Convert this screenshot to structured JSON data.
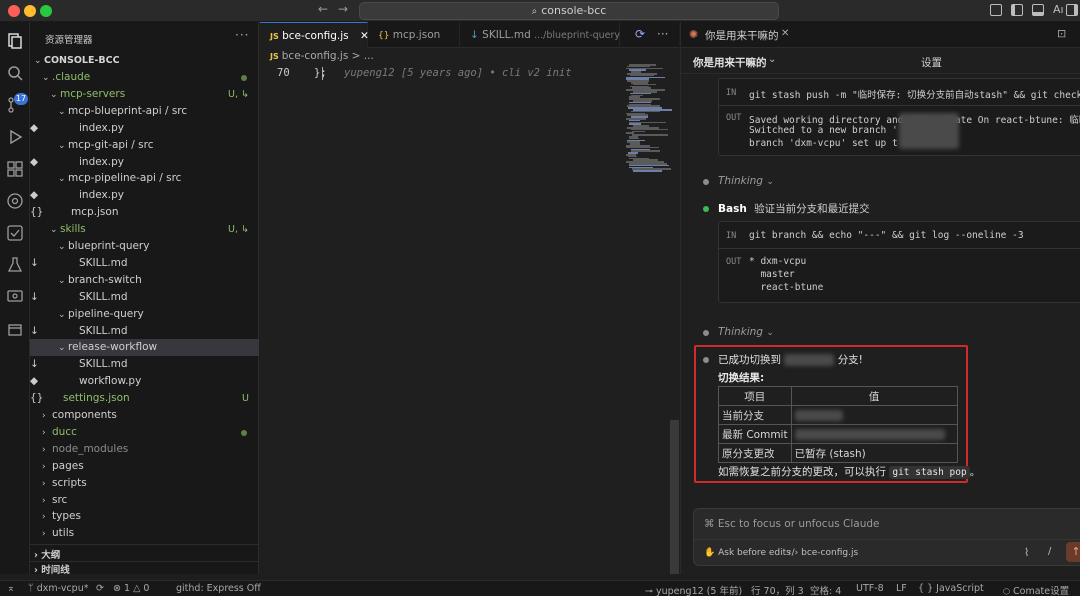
{
  "window": {
    "search": "console-bcc",
    "traffic_colors": [
      "#fe5f57",
      "#febc2e",
      "#28c840"
    ]
  },
  "activity": {
    "scm_badge": "17"
  },
  "explorer": {
    "title": "资源管理器",
    "more": "···",
    "project": "CONSOLE-BCC",
    "tree": [
      {
        "label": ".claude",
        "type": "folder",
        "open": true,
        "indent": 1,
        "color": "#8fbf6a",
        "dot": true
      },
      {
        "label": "mcp-servers",
        "type": "folder",
        "open": true,
        "indent": 2,
        "color": "#8fbf6a",
        "status": "U, ↳"
      },
      {
        "label": "mcp-blueprint-api / src",
        "type": "folder",
        "open": true,
        "indent": 3,
        "color": "#d0d0d0"
      },
      {
        "label": "index.py",
        "type": "py",
        "indent": 4,
        "color": "#d0d0d0"
      },
      {
        "label": "mcp-git-api / src",
        "type": "folder",
        "open": true,
        "indent": 3,
        "color": "#d0d0d0"
      },
      {
        "label": "index.py",
        "type": "py",
        "indent": 4,
        "color": "#d0d0d0"
      },
      {
        "label": "mcp-pipeline-api / src",
        "type": "folder",
        "open": true,
        "indent": 3,
        "color": "#d0d0d0"
      },
      {
        "label": "index.py",
        "type": "py",
        "indent": 4,
        "color": "#d0d0d0"
      },
      {
        "label": "mcp.json",
        "type": "json",
        "indent": 3,
        "color": "#d0d0d0"
      },
      {
        "label": "skills",
        "type": "folder",
        "open": true,
        "indent": 2,
        "color": "#8fbf6a",
        "status": "U, ↳"
      },
      {
        "label": "blueprint-query",
        "type": "folder",
        "open": true,
        "indent": 3,
        "color": "#d0d0d0"
      },
      {
        "label": "SKILL.md",
        "type": "md",
        "indent": 4,
        "color": "#d0d0d0"
      },
      {
        "label": "branch-switch",
        "type": "folder",
        "open": true,
        "indent": 3,
        "color": "#d0d0d0"
      },
      {
        "label": "SKILL.md",
        "type": "md",
        "indent": 4,
        "color": "#d0d0d0"
      },
      {
        "label": "pipeline-query",
        "type": "folder",
        "open": true,
        "indent": 3,
        "color": "#d0d0d0"
      },
      {
        "label": "SKILL.md",
        "type": "md",
        "indent": 4,
        "color": "#d0d0d0"
      },
      {
        "label": "release-workflow",
        "type": "folder",
        "open": true,
        "indent": 3,
        "color": "#d0d0d0",
        "selected": true
      },
      {
        "label": "SKILL.md",
        "type": "md",
        "indent": 4,
        "color": "#d0d0d0"
      },
      {
        "label": "workflow.py",
        "type": "py",
        "indent": 4,
        "color": "#d0d0d0"
      },
      {
        "label": "settings.json",
        "type": "json",
        "indent": 2,
        "color": "#8fbf6a",
        "status": "U"
      },
      {
        "label": "components",
        "type": "folder",
        "open": false,
        "indent": 1,
        "color": "#d0d0d0"
      },
      {
        "label": "ducc",
        "type": "folder",
        "open": false,
        "indent": 1,
        "color": "#8fbf6a",
        "dot": true
      },
      {
        "label": "node_modules",
        "type": "folder",
        "open": false,
        "indent": 1,
        "color": "#8c8c8c"
      },
      {
        "label": "pages",
        "type": "folder",
        "open": false,
        "indent": 1,
        "color": "#d0d0d0"
      },
      {
        "label": "scripts",
        "type": "folder",
        "open": false,
        "indent": 1,
        "color": "#d0d0d0"
      },
      {
        "label": "src",
        "type": "folder",
        "open": false,
        "indent": 1,
        "color": "#d0d0d0"
      },
      {
        "label": "types",
        "type": "folder",
        "open": false,
        "indent": 1,
        "color": "#d0d0d0"
      },
      {
        "label": "utils",
        "type": "folder",
        "open": false,
        "indent": 1,
        "color": "#d0d0d0"
      }
    ],
    "outline": "大纲",
    "timeline": "时间线"
  },
  "editor": {
    "tabs": [
      {
        "icon": "JS",
        "label": "bce-config.js",
        "active": true,
        "closable": true
      },
      {
        "icon": "{}",
        "label": "mcp.json",
        "active": false
      },
      {
        "icon": "↓",
        "label": "SKILL.md",
        "hint": ".../blueprint-query",
        "active": false
      }
    ],
    "breadcrumb_icon": "JS",
    "breadcrumb": "bce-config.js > ...",
    "line_number": "70",
    "code": "};",
    "blame": "yupeng12 [5 years ago] • cli v2 init"
  },
  "claude": {
    "tab_title": "你是用来干嘛的",
    "title": "你是用来干嘛的",
    "settings": "设置",
    "block1_in_tag": "IN",
    "block1_in": "git stash push -m \"临时保存: 切换分支前自动stash\" && git checkout dxm",
    "block1_out_tag": "OUT",
    "block1_out": [
      "Saved working directory and index state On react-btune: 临时保存: 切",
      "Switched to a new branch '",
      "branch 'dxm-vcpu' set up t"
    ],
    "thinking1": "Thinking",
    "bash_label": "Bash",
    "bash_desc": "验证当前分支和最近提交",
    "block2_in_tag": "IN",
    "block2_in": "git branch && echo \"---\" && git log --oneline -3",
    "block2_out_tag": "OUT",
    "block2_out": [
      "* dxm-vcpu",
      "  master",
      "  react-btune"
    ],
    "thinking2": "Thinking",
    "success_prefix": "已成功切换到",
    "success_suffix": "分支!",
    "result_heading": "切换结果:",
    "table_headers": [
      "项目",
      "值"
    ],
    "table_rows": [
      {
        "item": "当前分支",
        "value": ""
      },
      {
        "item": "最新 Commit",
        "value": ""
      },
      {
        "item": "原分支更改",
        "value": "已暂存 (stash)"
      }
    ],
    "hint_prefix": "如需恢复之前分支的更改，可以执行",
    "hint_code": "git stash pop",
    "hint_suffix": "。",
    "input_placeholder": "⌘ Esc to focus or unfocus Claude",
    "ask_label": "Ask before edits",
    "file_ref": "bce-config.js"
  },
  "status": {
    "branch": "dxm-vcpu*",
    "errors": "1",
    "warnings": "0",
    "githd": "githd: Express Off",
    "blame": "yupeng12 (5 年前)",
    "position": "行 70，列 3",
    "spaces": "空格: 4",
    "encoding": "UTF-8",
    "eol": "LF",
    "language": "JavaScript",
    "comate": "Comate设置"
  }
}
